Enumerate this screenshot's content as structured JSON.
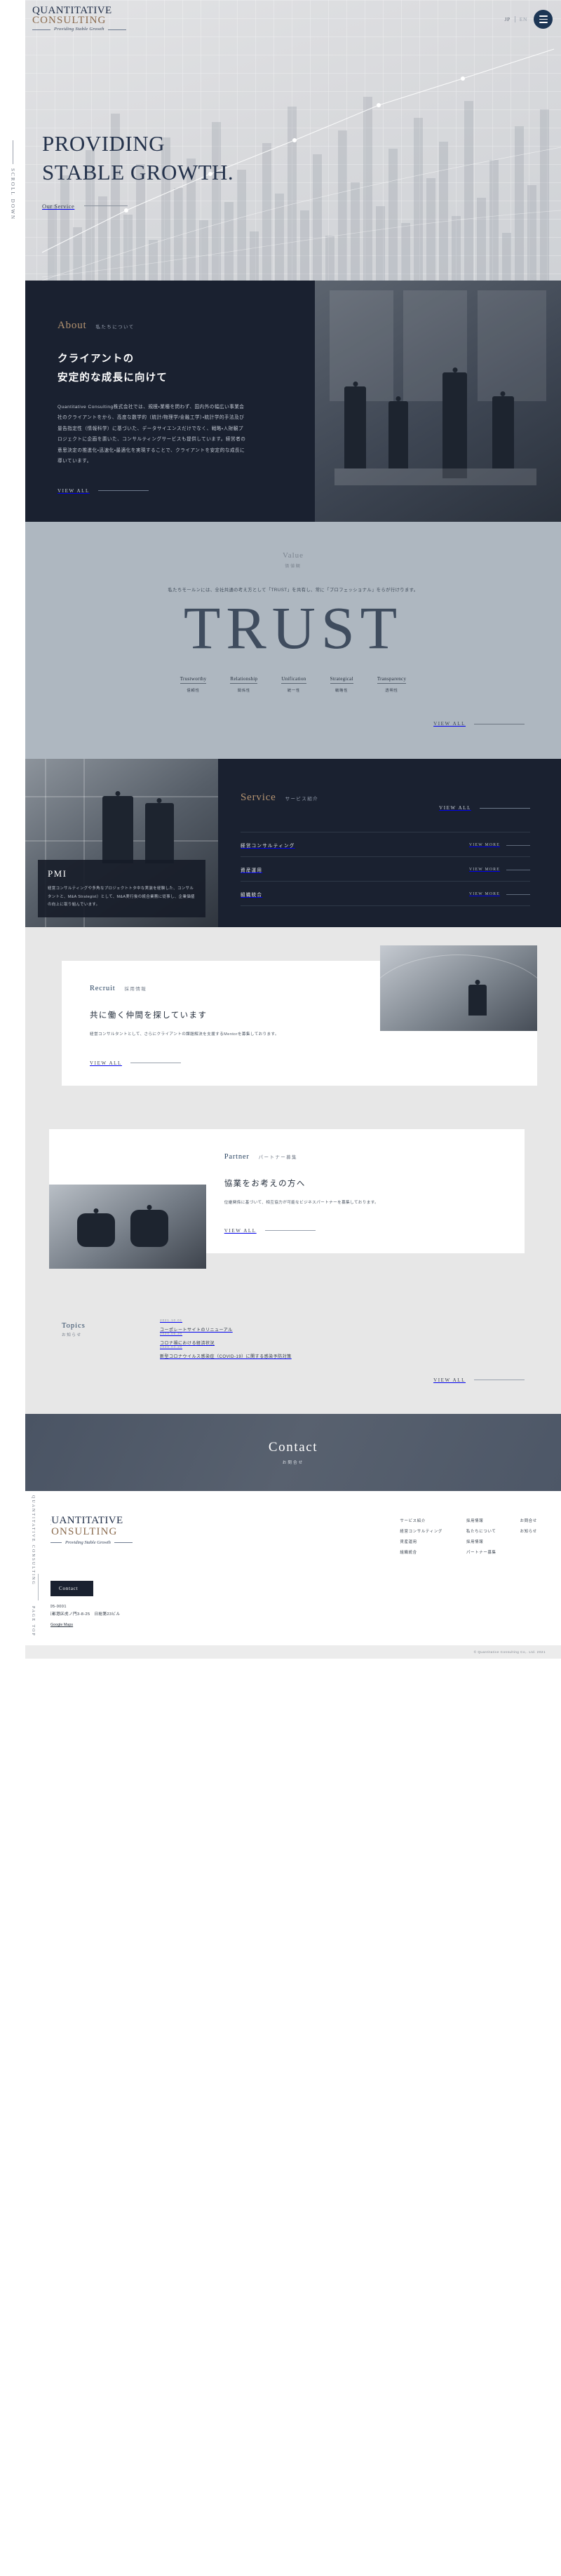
{
  "brand": {
    "line1": "QUANTITATIVE",
    "line2": "CONSULTING",
    "tagline": "Providing Stable Growth"
  },
  "header": {
    "lang_jp": "JP",
    "lang_en": "EN",
    "menu_icon": "hamburger-menu-icon"
  },
  "hero": {
    "title_line1": "PROVIDING",
    "title_line2": "STABLE GROWTH.",
    "our_service": "Our Service",
    "scroll": "SCROLL DOWN"
  },
  "about": {
    "en": "About",
    "jp": "私たちについて",
    "heading_line1": "クライアントの",
    "heading_line2": "安定的な成長に向けて",
    "body": "Quantitative Consulting株式会社では、規模・業種を問わず、国内外の幅広い事業会社のクライアントをから、高度な数学的（統計/物理学/金融工学）・統計学的手法及び量告指定性（情報科学）に基づいた、データサイエンスだけでなく、戦略・人財観プロジェクトに企画を置いた、コンサルティングサービスも提供しています。経営者の意思決定の推進化・迅速化・最適化を実現することで、クライアントを安定的な成長に導いています。",
    "view_all": "VIEW ALL"
  },
  "value": {
    "en": "Value",
    "jp": "価値観",
    "lead": "私たちモールンには、全社共通の考え方として「TRUST」を共有し、常に「プロフェッショナル」をらが行けります。",
    "word": "TRUST",
    "view_all": "VIEW ALL",
    "pillars": [
      {
        "en": "Trustworthy",
        "jp": "信頼性"
      },
      {
        "en": "Relationship",
        "jp": "関係性"
      },
      {
        "en": "Unification",
        "jp": "統一性"
      },
      {
        "en": "Strategical",
        "jp": "戦略性"
      },
      {
        "en": "Transparency",
        "jp": "透明性"
      }
    ]
  },
  "service": {
    "en": "Service",
    "jp": "サービス紹介",
    "view_all": "VIEW ALL",
    "card_tag": "PMI",
    "card_body": "経営コンサルティングや多角なプロジェクトトタ中な実装を経験した、コンサルタントと、M&A Strategist）として、M&A実行後の統合業務に従事し、企業価値の向上に取り組んでいます。",
    "items": [
      {
        "name": "経営コンサルティング",
        "more": "VIEW MORE"
      },
      {
        "name": "資産運用",
        "more": "VIEW MORE"
      },
      {
        "name": "組織統合",
        "more": "VIEW MORE"
      }
    ]
  },
  "recruit": {
    "en": "Recruit",
    "jp": "採用情報",
    "heading": "共に働く仲間を探しています",
    "body": "経営コンサルタントとして、さらにクライアントの課題解決を支援するMentorを募集しております。",
    "view_all": "VIEW ALL"
  },
  "partner": {
    "en": "Partner",
    "jp": "パートナー募集",
    "heading": "協業をお考えの方へ",
    "body": "位継関係に基づいて、相互協力が可能なビジネスパートナーを募集しております。",
    "view_all": "VIEW ALL"
  },
  "topics": {
    "en": "Topics",
    "jp": "お知らせ",
    "view_all": "VIEW ALL",
    "items": [
      {
        "date": "2021.10.01",
        "title": "コーポレートサイトのリニューアル"
      },
      {
        "date": "2020.05.20",
        "title": "コロナ禍における経済状況"
      },
      {
        "date": "2020.04.20",
        "title": "新型コロナウイルス感染症（COVID-19）に関する感染予防対策"
      }
    ]
  },
  "contact_cta": {
    "en": "Contact",
    "jp": "お問合せ"
  },
  "footer": {
    "contact_button": "Contact",
    "postal": "〒105-0001",
    "address": "東京都港区虎ノ門3-8-25　日総第23ビル",
    "maps_label": "Google Maps",
    "maps_icon": "map-pin-icon",
    "page_top": "PAGE TOP",
    "side_brand": "QUANTITATIVE CONSULTING",
    "copyright": "© Quantitative Consulting Co,. Ltd. 2021",
    "nav": [
      {
        "items": [
          "サービス紹介",
          "経営コンサルティング",
          "資産運用",
          "組織統合"
        ]
      },
      {
        "items": [
          "採用情報",
          "私たちについて",
          "採用情報",
          "パートナー募集"
        ]
      },
      {
        "items": [
          "お問合せ",
          "お知らせ"
        ]
      }
    ]
  },
  "colors": {
    "navy": "#1a2130",
    "gold": "#b59471",
    "steel": "#aeb7c0",
    "accent_blue": "#1c3554"
  }
}
